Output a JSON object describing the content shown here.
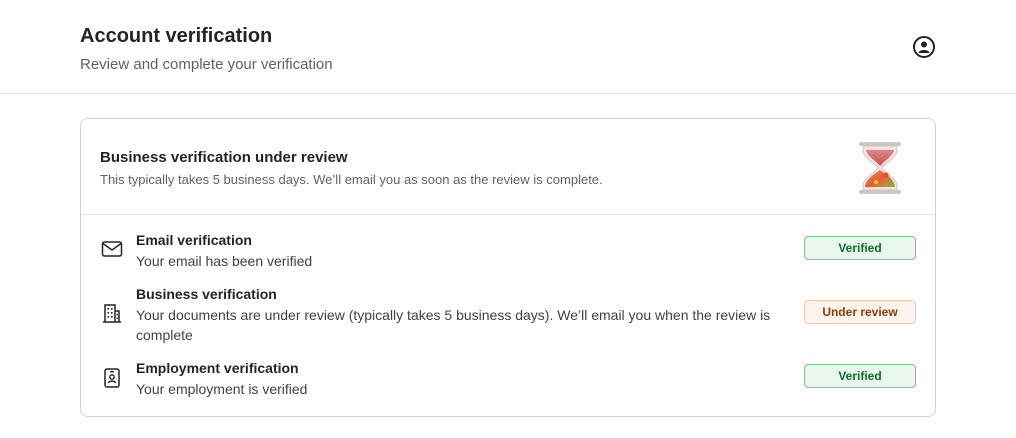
{
  "header": {
    "title": "Account verification",
    "subtitle": "Review and complete your verification",
    "profile_icon": "person-circle-icon"
  },
  "summary": {
    "title": "Business verification under review",
    "description": "This typically takes 5 business days. We’ll email you as soon as the review is complete.",
    "illustration": "hourglass-icon"
  },
  "items": [
    {
      "icon": "mail-icon",
      "title": "Email verification",
      "description": "Your email has been verified",
      "status": "Verified"
    },
    {
      "icon": "building-icon",
      "title": "Business verification",
      "description": "Your documents are under review (typically takes 5 business days). We’ll email you when the review is complete",
      "status": "Under review"
    },
    {
      "icon": "id-badge-icon",
      "title": "Employment verification",
      "description": "Your employment is verified",
      "status": "Verified"
    }
  ],
  "colors": {
    "verified_bg": "#eaf7ec",
    "verified_text": "#0e6b28",
    "review_bg": "#fdf4ec",
    "review_text": "#8a3c0e"
  }
}
